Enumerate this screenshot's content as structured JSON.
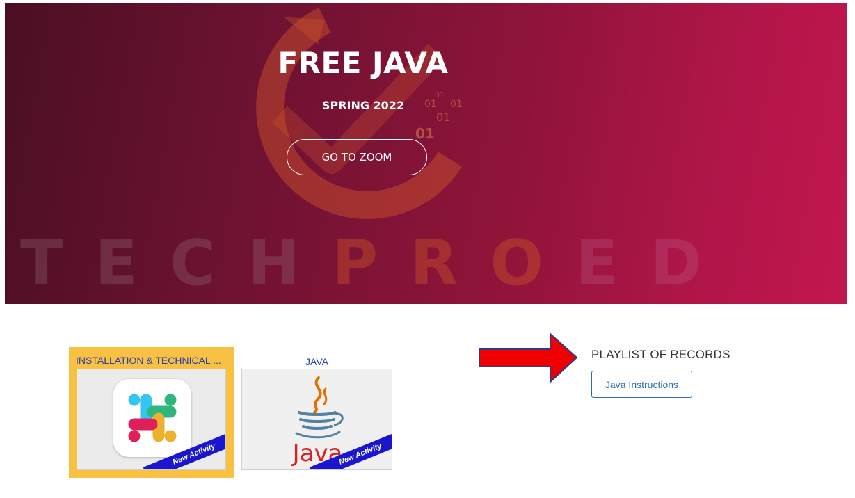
{
  "hero": {
    "title": "FREE JAVA",
    "subtitle": "SPRING 2022",
    "zoom_button": "GO TO ZOOM",
    "brand_watermark": [
      "TECH",
      "PRO",
      "ED"
    ],
    "binary_digits": [
      "01",
      "01",
      "01",
      "01",
      "01"
    ],
    "gradient_colors": [
      "#4a0f22",
      "#c2174d"
    ]
  },
  "cards": [
    {
      "title": "INSTALLATION & TECHNICAL ...",
      "icon": "slack-logo-icon",
      "badge": "New Activity",
      "highlight_color": "#f8c141"
    },
    {
      "title": "JAVA",
      "icon": "java-logo-icon",
      "logo_text": "Java",
      "badge": "New Activity"
    }
  ],
  "playlist": {
    "heading": "PLAYLIST OF RECORDS",
    "items": [
      "Java Instructions"
    ]
  },
  "annotation": {
    "arrow_icon": "red-arrow-icon",
    "arrow_color": "#ee0000"
  }
}
